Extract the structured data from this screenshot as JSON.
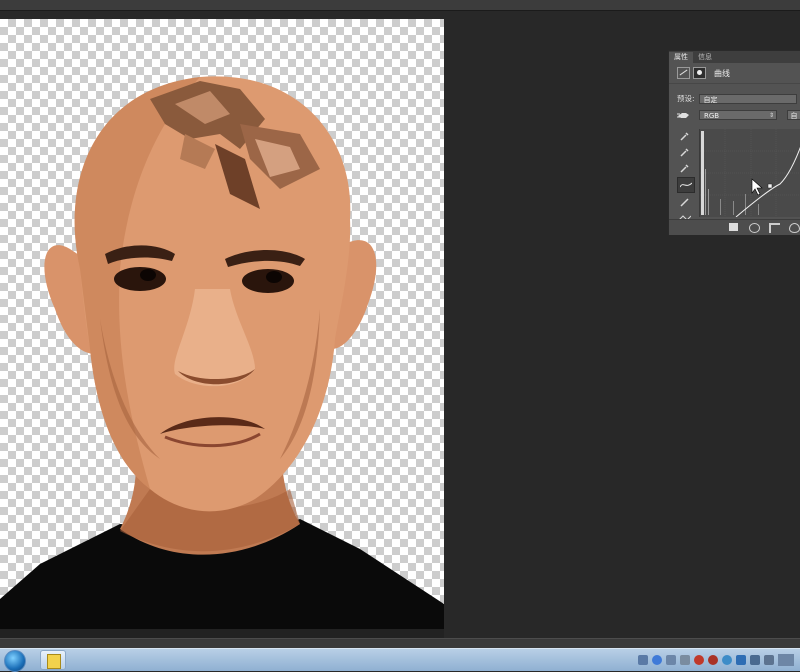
{
  "properties_panel": {
    "tabs": [
      "属性",
      "信息"
    ],
    "header_title": "曲线",
    "preset_label": "预设:",
    "preset_value": "自定",
    "channel_value": "RGB",
    "auto_label": "自"
  },
  "tools": [
    "hand-adjust-icon",
    "eyedropper-black-icon",
    "eyedropper-gray-icon",
    "eyedropper-white-icon",
    "curve-point-icon",
    "pencil-icon",
    "smooth-icon"
  ],
  "colors": {
    "workspace": "#282828",
    "panel": "#535353",
    "taskbar": "#a7c1de"
  }
}
